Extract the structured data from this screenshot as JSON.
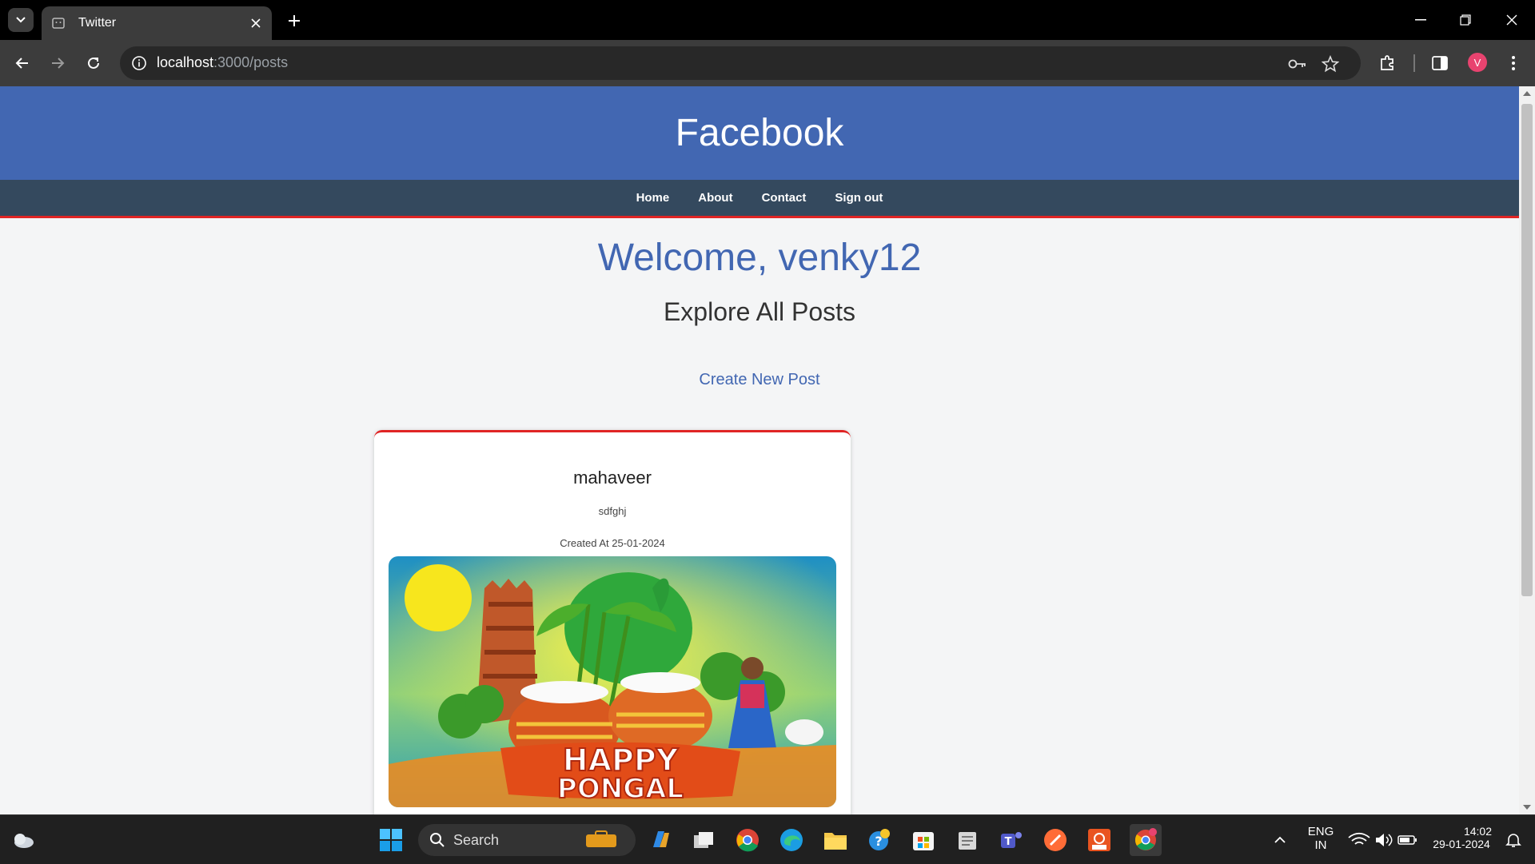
{
  "browser": {
    "tab_title": "Twitter",
    "url_host": "localhost",
    "url_path": ":3000/posts",
    "profile_initial": "V"
  },
  "site": {
    "brand": "Facebook",
    "nav": [
      "Home",
      "About",
      "Contact",
      "Sign out"
    ],
    "welcome": "Welcome, venky12",
    "subtitle": "Explore All Posts",
    "create_link": "Create New Post",
    "accent": "#4267b2",
    "nav_bg": "#34495e",
    "alert_red": "#e02424"
  },
  "post": {
    "author": "mahaveer",
    "body": "sdfghj",
    "created": "Created At 25-01-2024",
    "image_text": [
      "HAPPY",
      "PONGAL"
    ]
  },
  "taskbar": {
    "search_label": "Search",
    "lang_top": "ENG",
    "lang_bottom": "IN",
    "time": "14:02",
    "date": "29-01-2024"
  }
}
